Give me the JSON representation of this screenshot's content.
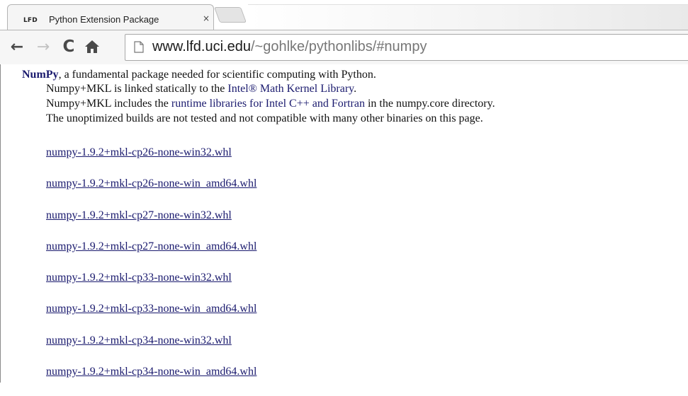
{
  "browser": {
    "tab": {
      "favicon_text": "LFD",
      "title": "Python Extension Package",
      "close_glyph": "×"
    },
    "nav": {
      "back_glyph": "←",
      "forward_glyph": "→",
      "reload_glyph": "C"
    },
    "address": {
      "host": "www.lfd.uci.edu",
      "path": "/~gohlke/pythonlibs/#numpy"
    }
  },
  "page": {
    "heading": "NumPy",
    "heading_rest": ", a fundamental package needed for scientific computing with Python.",
    "line1_pre": "Numpy+MKL is linked statically to the ",
    "line1_link": "Intel® Math Kernel Library",
    "line1_post": ".",
    "line2_pre": "Numpy+MKL includes the ",
    "line2_link": "runtime libraries for Intel C++ and Fortran",
    "line2_post": " in the numpy.core directory.",
    "line3": "The unoptimized builds are not tested and not compatible with many other binaries on this page.",
    "downloads": [
      "numpy-1.9.2+mkl-cp26-none-win32.whl",
      "numpy-1.9.2+mkl-cp26-none-win_amd64.whl",
      "numpy-1.9.2+mkl-cp27-none-win32.whl",
      "numpy-1.9.2+mkl-cp27-none-win_amd64.whl",
      "numpy-1.9.2+mkl-cp33-none-win32.whl",
      "numpy-1.9.2+mkl-cp33-none-win_amd64.whl",
      "numpy-1.9.2+mkl-cp34-none-win32.whl",
      "numpy-1.9.2+mkl-cp34-none-win_amd64.whl"
    ]
  },
  "colors": {
    "link": "#1a1a6e",
    "url_path": "#777777"
  }
}
